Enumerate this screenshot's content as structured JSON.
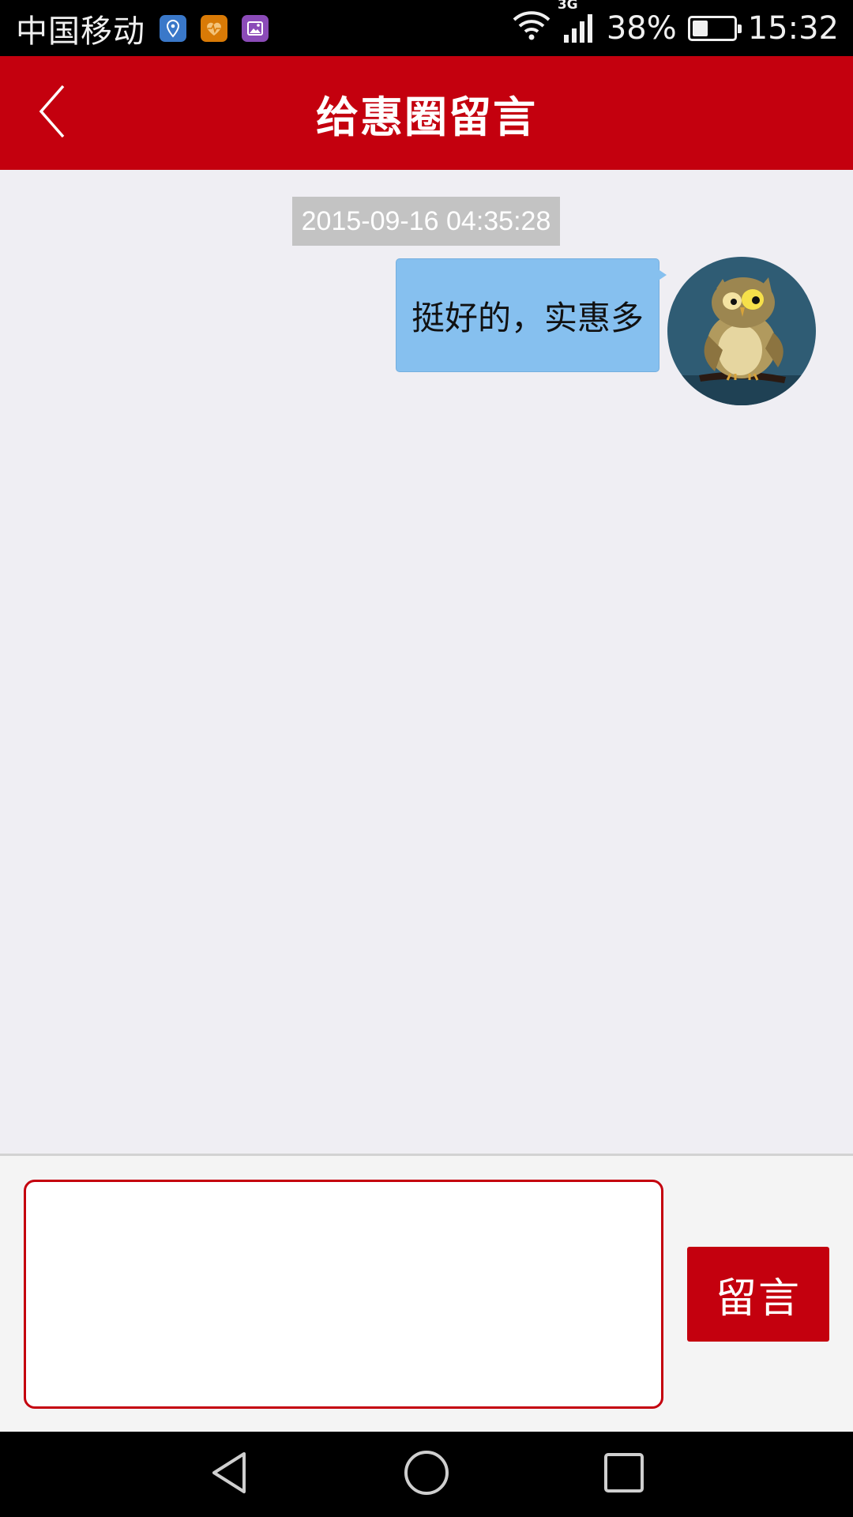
{
  "status_bar": {
    "carrier": "中国移动",
    "network_type": "3G",
    "battery_percent": "38%",
    "battery_level": 0.38,
    "time": "15:32",
    "app_icons": [
      "location-app-icon",
      "health-app-icon",
      "gallery-app-icon"
    ]
  },
  "header": {
    "title": "给惠圈留言",
    "back_icon": "chevron-left-icon"
  },
  "chat": {
    "messages": [
      {
        "timestamp": "2015-09-16 04:35:28",
        "text": "挺好的，实惠多",
        "avatar": "owl-avatar"
      }
    ]
  },
  "composer": {
    "placeholder": "",
    "value": "",
    "send_label": "留言"
  },
  "nav": {
    "back_icon": "triangle-back-icon",
    "home_icon": "circle-home-icon",
    "recent_icon": "square-recent-icon"
  },
  "colors": {
    "primary": "#c4000e",
    "bubble": "#86c0ef",
    "background": "#efeef3",
    "timestamp_bg": "#c3c3c3"
  }
}
